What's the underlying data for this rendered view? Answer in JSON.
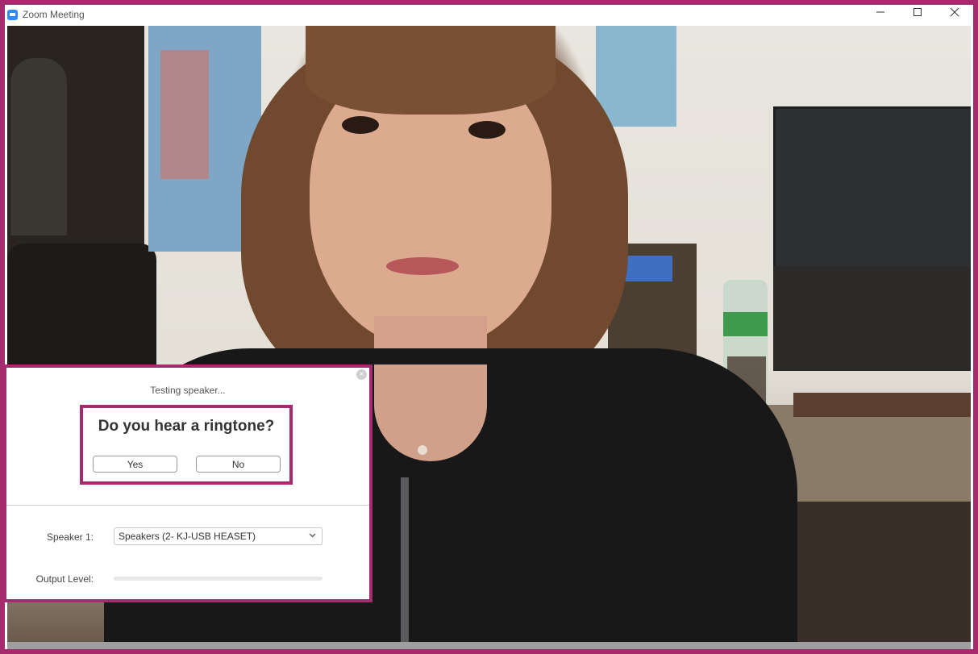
{
  "window": {
    "title": "Zoom Meeting",
    "app_icon": "zoom-app-icon",
    "controls": [
      "minimize-icon",
      "maximize-icon",
      "close-icon"
    ]
  },
  "dialog": {
    "status": "Testing speaker...",
    "question": "Do you hear a ringtone?",
    "yes_label": "Yes",
    "no_label": "No",
    "speaker_label": "Speaker 1:",
    "speaker_value": "Speakers (2- KJ-USB HEASET)",
    "output_label": "Output Level:",
    "output_level": 0
  },
  "colors": {
    "highlight": "#a52a6e",
    "zoom_blue": "#2d8cff"
  }
}
